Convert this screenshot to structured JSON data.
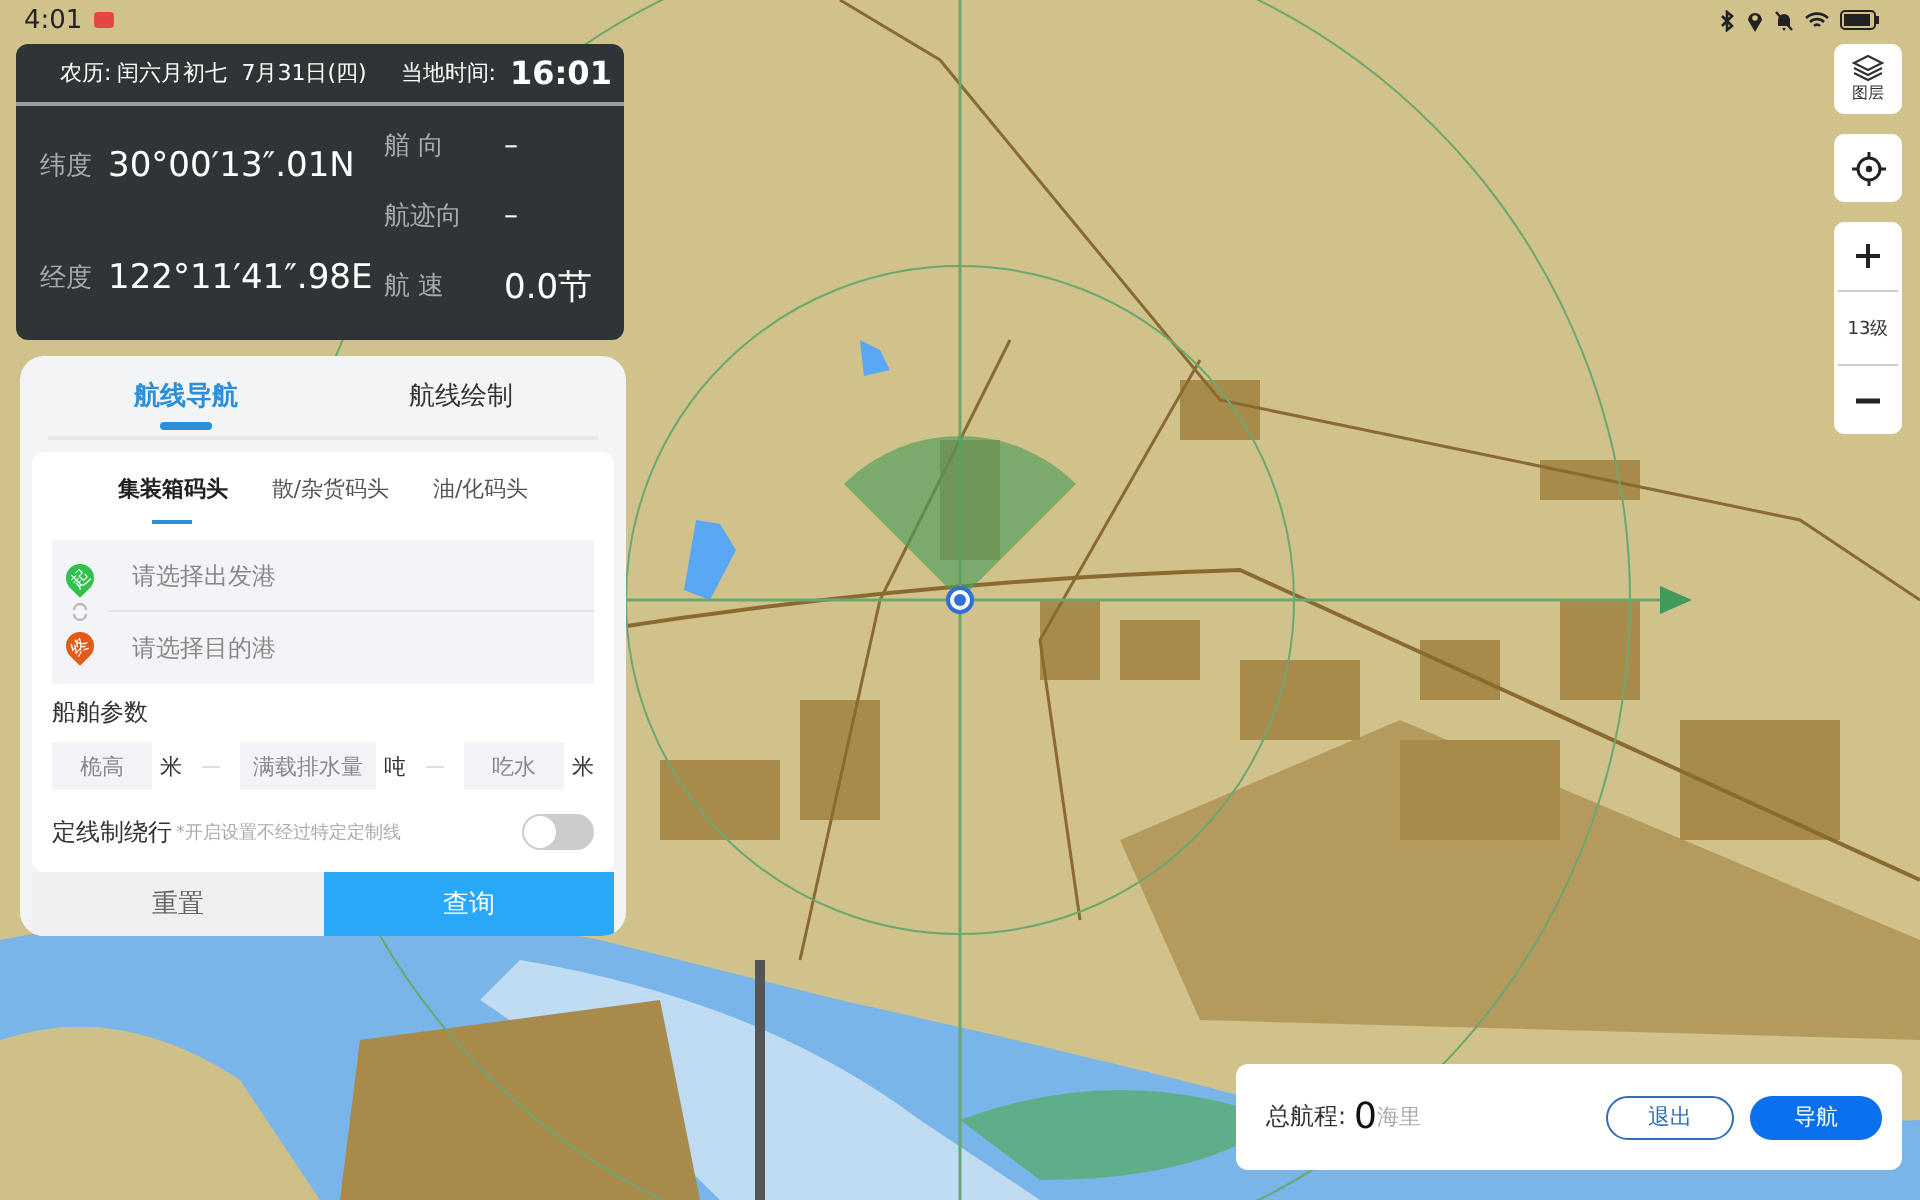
{
  "status_bar": {
    "time": "4:01"
  },
  "info_panel": {
    "lunar_label": "农历:",
    "lunar_date": "闰六月初七  7月31日(四)",
    "local_time_label": "当地时间:",
    "local_time": "16:01",
    "latitude_label": "纬度",
    "latitude": "30°00′13″.01N",
    "longitude_label": "经度",
    "longitude": "122°11′41″.98E",
    "heading_label": "艏 向",
    "heading": "–",
    "course_label": "航迹向",
    "course": "–",
    "speed_label": "航 速",
    "speed": "0.0节"
  },
  "route_panel": {
    "tabs": [
      {
        "label": "航线导航",
        "selected": true
      },
      {
        "label": "航线绘制",
        "selected": false
      }
    ],
    "terminal_tabs": [
      {
        "label": "集装箱码头",
        "selected": true
      },
      {
        "label": "散/杂货码头",
        "selected": false
      },
      {
        "label": "油/化码头",
        "selected": false
      }
    ],
    "origin": {
      "badge": "起",
      "placeholder": "请选择出发港"
    },
    "destination": {
      "badge": "终",
      "placeholder": "请选择目的港"
    },
    "params_title": "船舶参数",
    "params": [
      {
        "placeholder": "桅高",
        "unit": "米"
      },
      {
        "placeholder": "满载排水量",
        "unit": "吨"
      },
      {
        "placeholder": "吃水",
        "unit": "米"
      }
    ],
    "avoid": {
      "label": "定线制绕行",
      "note": "*开启设置不经过特定定制线",
      "on": false
    },
    "reset_button": "重置",
    "query_button": "查询"
  },
  "map_controls": {
    "layers_label": "图层",
    "zoom_level": "13级"
  },
  "summary": {
    "label": "总航程:",
    "value": "0",
    "unit": "海里",
    "exit_button": "退出",
    "navigate_button": "导航"
  }
}
